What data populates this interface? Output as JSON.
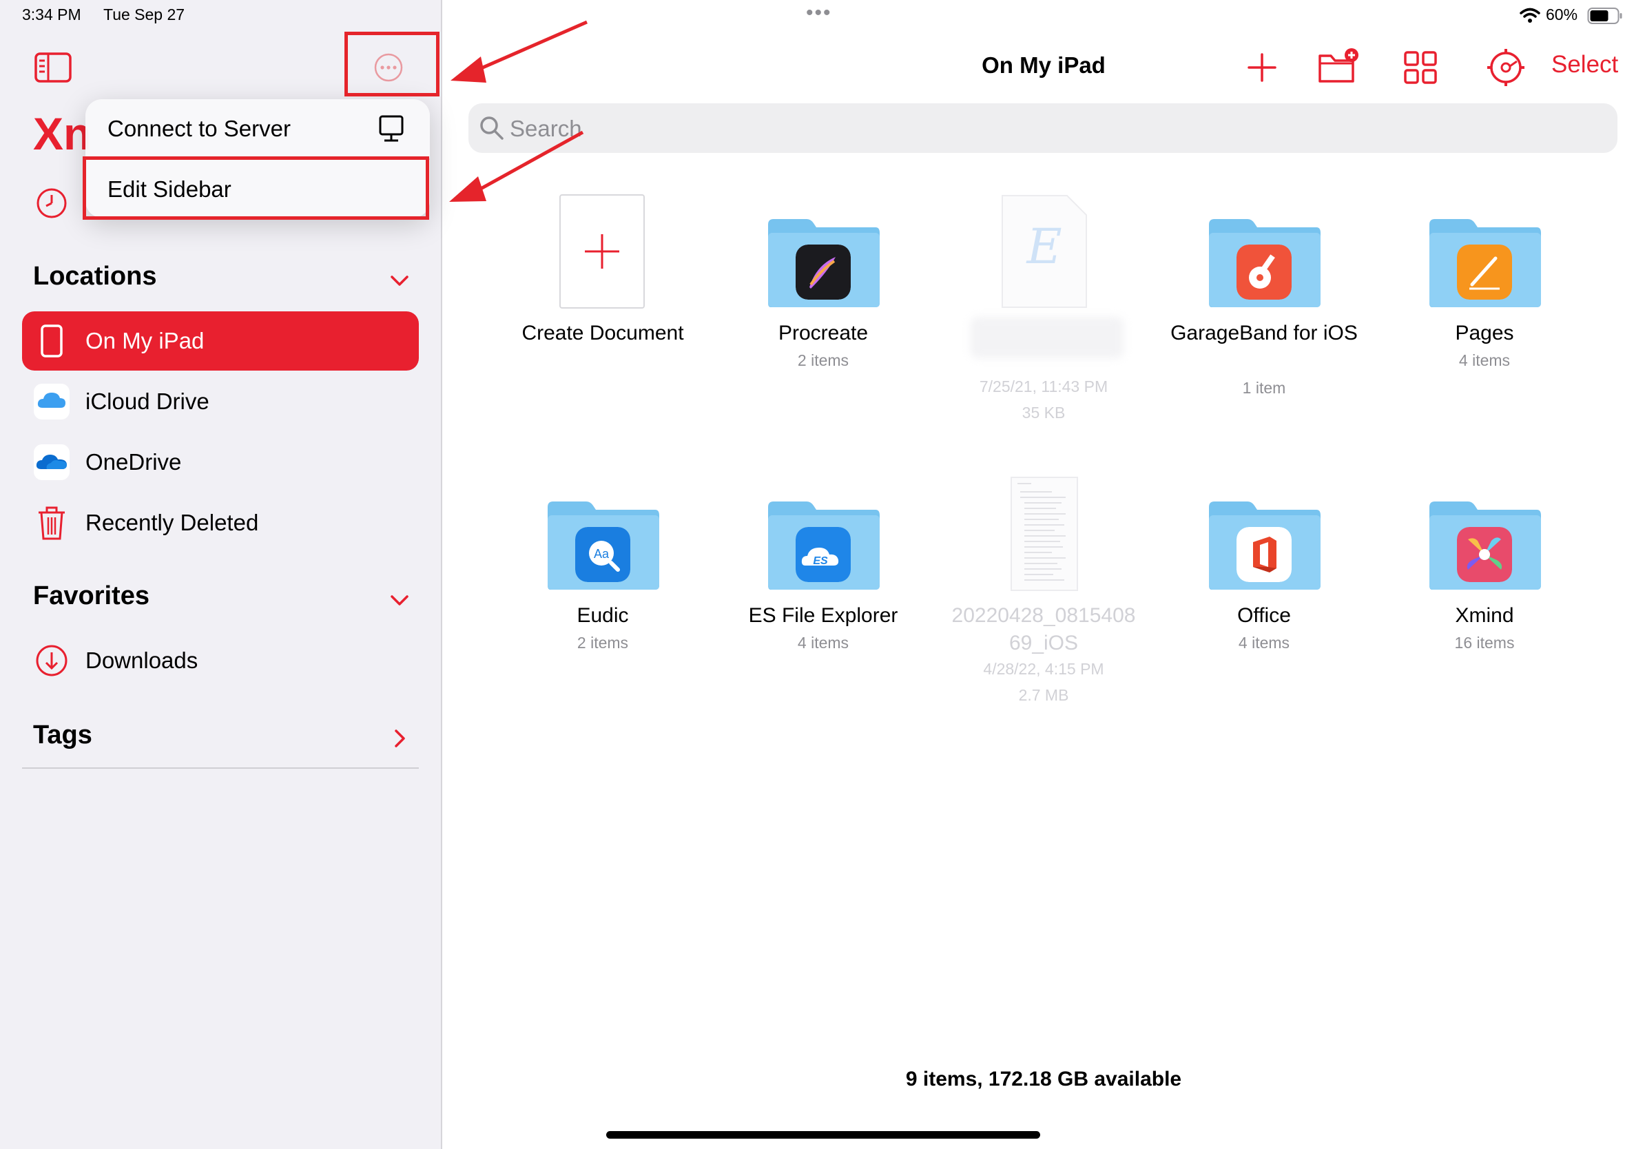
{
  "status_bar": {
    "time": "3:34 PM",
    "date": "Tue Sep 27",
    "battery": "60%"
  },
  "sidebar": {
    "app_name_partial": "Xn",
    "locations_title": "Locations",
    "favorites_title": "Favorites",
    "tags_title": "Tags",
    "locations": [
      {
        "label": "On My iPad",
        "active": true
      },
      {
        "label": "iCloud Drive"
      },
      {
        "label": "OneDrive"
      },
      {
        "label": "Recently Deleted"
      }
    ],
    "favorites": [
      {
        "label": "Downloads"
      }
    ]
  },
  "popup_menu": {
    "items": [
      {
        "label": "Connect to Server"
      },
      {
        "label": "Edit Sidebar"
      }
    ]
  },
  "toolbar": {
    "title": "On My iPad",
    "select_label": "Select"
  },
  "search": {
    "placeholder": "Search"
  },
  "grid": {
    "items": [
      {
        "name": "Create Document",
        "meta": ""
      },
      {
        "name": "Procreate",
        "meta": "2 items"
      },
      {
        "name": "",
        "meta": "7/25/21, 11:43 PM",
        "meta2": "35 KB"
      },
      {
        "name": "GarageBand for iOS",
        "meta": "1 item"
      },
      {
        "name": "Pages",
        "meta": "4 items"
      },
      {
        "name": "Eudic",
        "meta": "2 items"
      },
      {
        "name": "ES File Explorer",
        "meta": "4 items"
      },
      {
        "name": "20220428_081540869_iOS",
        "meta": "4/28/22, 4:15 PM",
        "meta2": "2.7 MB"
      },
      {
        "name": "Office",
        "meta": "4 items"
      },
      {
        "name": "Xmind",
        "meta": "16 items"
      }
    ]
  },
  "footer": {
    "summary": "9 items, 172.18 GB available"
  },
  "colors": {
    "accent": "#e8202f",
    "folder": "#7ec8f2",
    "annotation": "#e5242b"
  }
}
